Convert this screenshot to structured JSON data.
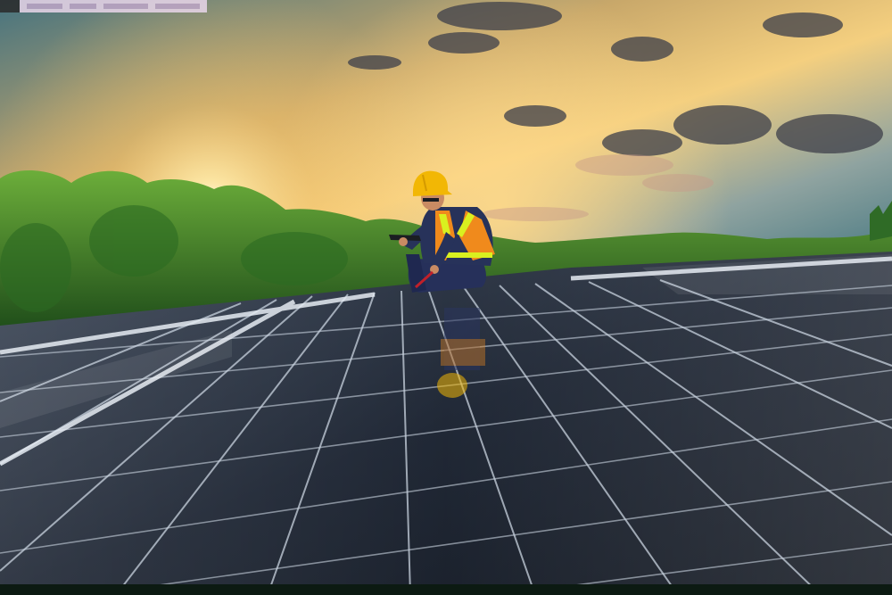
{
  "scene": {
    "subject": "worker",
    "colors": {
      "sky_top": "#4b7f8d",
      "sky_glow": "#f7c56d",
      "sun": "#fff6d0",
      "trees": "#3f8a2a",
      "panel": "#1c2533",
      "panel_grid": "#c9d3df",
      "helmet": "#f2b705",
      "vest": "#f08a1c",
      "uniform": "#27325a"
    }
  }
}
